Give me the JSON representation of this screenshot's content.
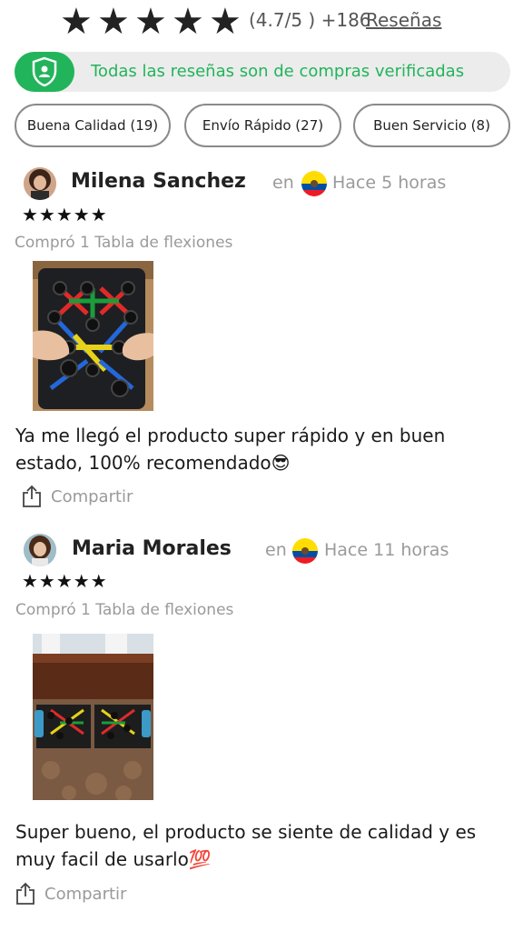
{
  "rating": {
    "star_count": 5,
    "score_text": "(4.7/5 ) +186",
    "reviews_link": "Reseñas"
  },
  "verified_banner": {
    "text": "Todas las reseñas son de compras verificadas",
    "icon": "shield-user-icon",
    "color": "#22b45a"
  },
  "filters": [
    {
      "label": "Buena Calidad (19)"
    },
    {
      "label": "Envío Rápido (27)"
    },
    {
      "label": "Buen Servicio (8)"
    }
  ],
  "reviews": [
    {
      "name": "Milena Sanchez",
      "en": "en",
      "flag": "ecuador-flag-icon",
      "time": "Hace 5 horas",
      "stars": "★★★★★",
      "purchase": "Compró 1 Tabla de flexiones",
      "text": "Ya me llegó el producto super rápido y en buen estado, 100% recomendado😎",
      "share": "Compartir"
    },
    {
      "name": "Maria Morales",
      "en": "en",
      "flag": "ecuador-flag-icon",
      "time": "Hace 11 horas",
      "stars": "★★★★★",
      "purchase": "Compró 1 Tabla de flexiones",
      "text": "Super bueno, el producto se siente de calidad y es muy facil de usarlo💯",
      "share": "Compartir"
    }
  ]
}
